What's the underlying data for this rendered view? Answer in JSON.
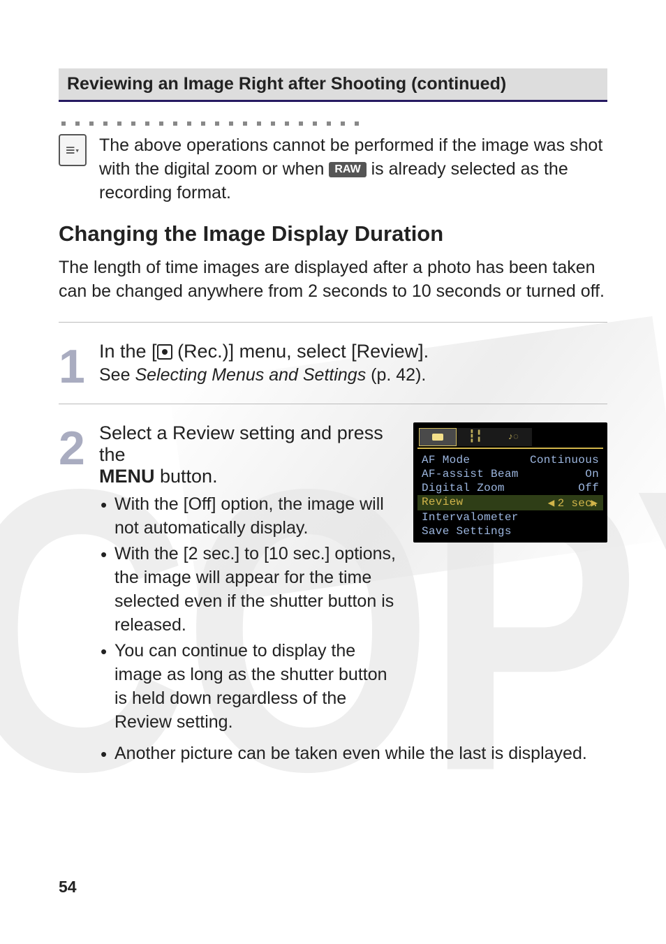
{
  "section_heading": "Reviewing an Image Right after Shooting (continued)",
  "note": {
    "text_before": "The above operations cannot be performed if the image was shot with the digital zoom or when ",
    "raw_label": "RAW",
    "text_after": " is already selected as the recording format."
  },
  "subheading": "Changing the Image Display Duration",
  "intro": "The length of time images are displayed after a photo has been taken can be changed anywhere from 2 seconds to 10 seconds or turned off.",
  "steps": [
    {
      "num": "1",
      "title_before": "In the [",
      "title_after": " (Rec.)] menu, select [Review].",
      "desc_prefix": "See ",
      "desc_emph": "Selecting Menus and Settings",
      "desc_suffix": " (p. 42)."
    },
    {
      "num": "2",
      "title_line1": "Select a Review setting and press the",
      "title_menu": "MENU",
      "title_line2_after": " button.",
      "bullets": [
        "With the [Off] option, the image will not automatically display.",
        "With the [2 sec.] to [10 sec.] options, the image will appear for the time selected even if the shutter button is released.",
        "You can continue to display the image as long as the shutter button is held down regardless of the Review setting.",
        "Another picture can be taken even while the last is displayed."
      ]
    }
  ],
  "camera_menu": {
    "tabs": [
      "camera",
      "tools",
      "person"
    ],
    "rows": [
      {
        "label": "AF Mode",
        "value": "Continuous"
      },
      {
        "label": "AF-assist Beam",
        "value": "On"
      },
      {
        "label": "Digital Zoom",
        "value": "Off"
      },
      {
        "label": "Review",
        "value": "2 sec.",
        "highlight": true
      },
      {
        "label": "Intervalometer",
        "value": ""
      },
      {
        "label": "Save Settings",
        "value": ""
      }
    ]
  },
  "page_number": "54"
}
